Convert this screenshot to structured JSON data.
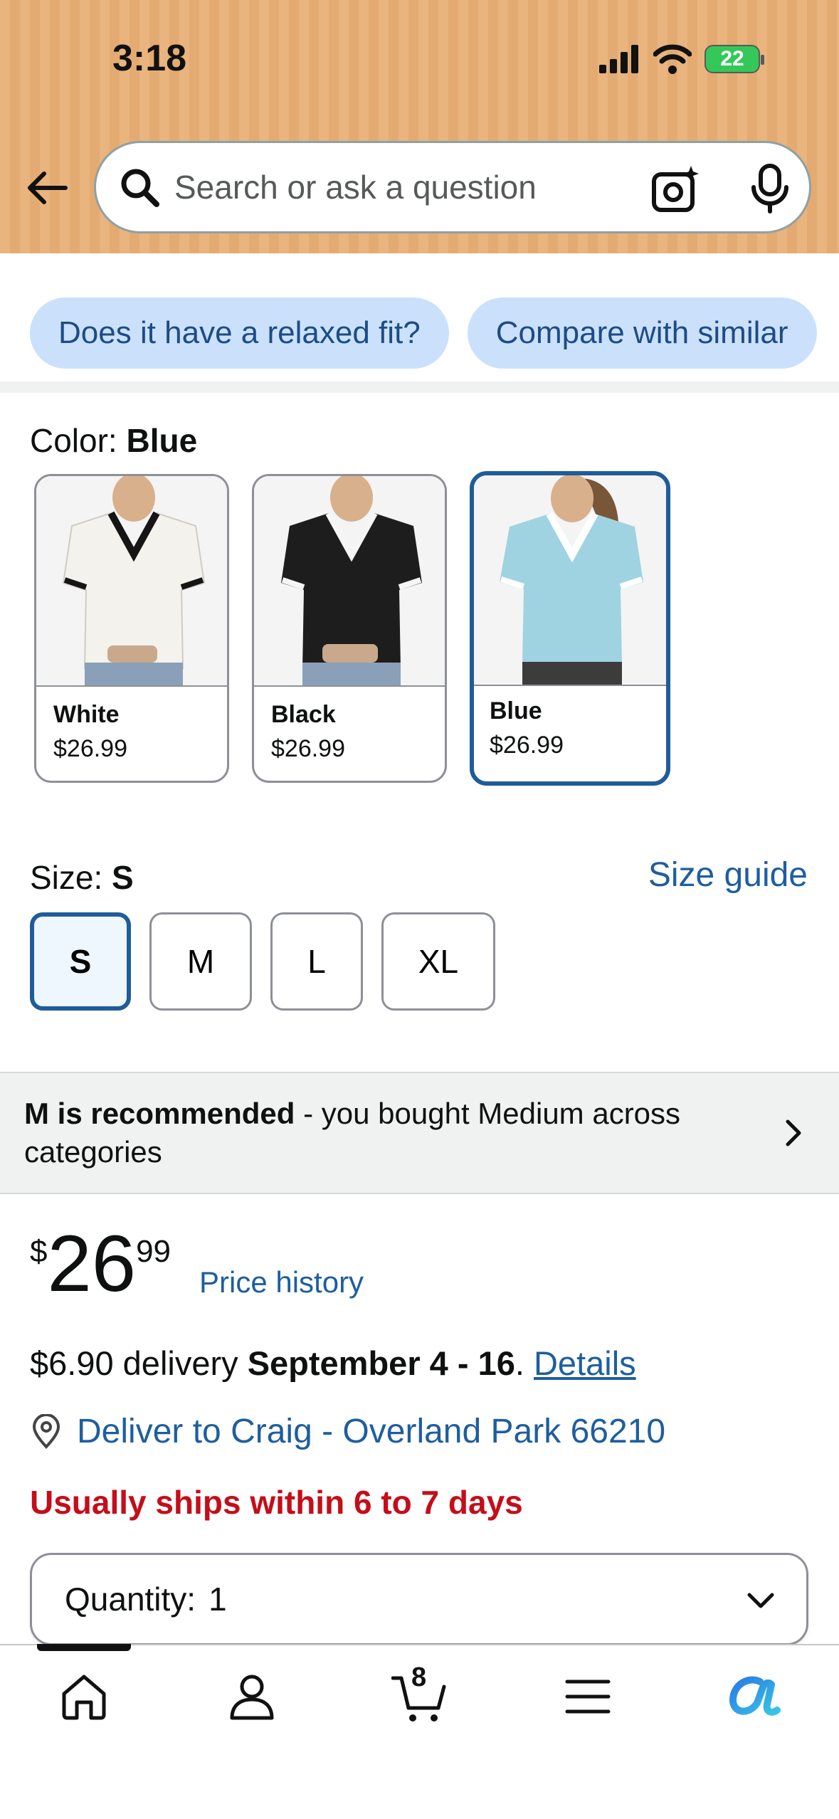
{
  "status_bar": {
    "time": "3:18",
    "battery": "22"
  },
  "search": {
    "placeholder": "Search or ask a question"
  },
  "chips": [
    "Does it have a relaxed fit?",
    "Compare with similar"
  ],
  "color": {
    "label": "Color: ",
    "selected": "Blue",
    "options": [
      {
        "name": "White",
        "price": "$26.99",
        "shirt_color": "#f4f2ec",
        "trim_color": "#151515"
      },
      {
        "name": "Black",
        "price": "$26.99",
        "shirt_color": "#1d1d1d",
        "trim_color": "#f5f5f5"
      },
      {
        "name": "Blue",
        "price": "$26.99",
        "shirt_color": "#9fd3e1",
        "trim_color": "#ffffff"
      }
    ]
  },
  "size": {
    "label": "Size: ",
    "selected": "S",
    "guide_label": "Size guide",
    "options": [
      "S",
      "M",
      "L",
      "XL"
    ]
  },
  "recommendation": {
    "bold": "M is recommended",
    "rest": " - you bought Medium across categories"
  },
  "price": {
    "symbol": "$",
    "whole": "26",
    "fraction": "99",
    "history_label": "Price history"
  },
  "delivery": {
    "prefix": "$6.90 delivery ",
    "date": "September 4 - 16",
    "suffix": ". ",
    "details_label": "Details"
  },
  "deliver_to": "Deliver to Craig - Overland Park 66210",
  "ships_notice": "Usually ships within 6 to 7 days",
  "quantity": {
    "label": "Quantity:",
    "value": "1"
  },
  "bottom_nav": {
    "cart_count": "8",
    "items": [
      "home-icon",
      "account-icon",
      "cart-icon",
      "menu-icon",
      "rufus-icon"
    ]
  },
  "colors": {
    "accent_blue": "#1f5c99",
    "link_blue": "#1e5e9e",
    "alert_red": "#c40e1a",
    "chip_bg": "#cbe1fb",
    "header_orange": "#e9b47e"
  }
}
